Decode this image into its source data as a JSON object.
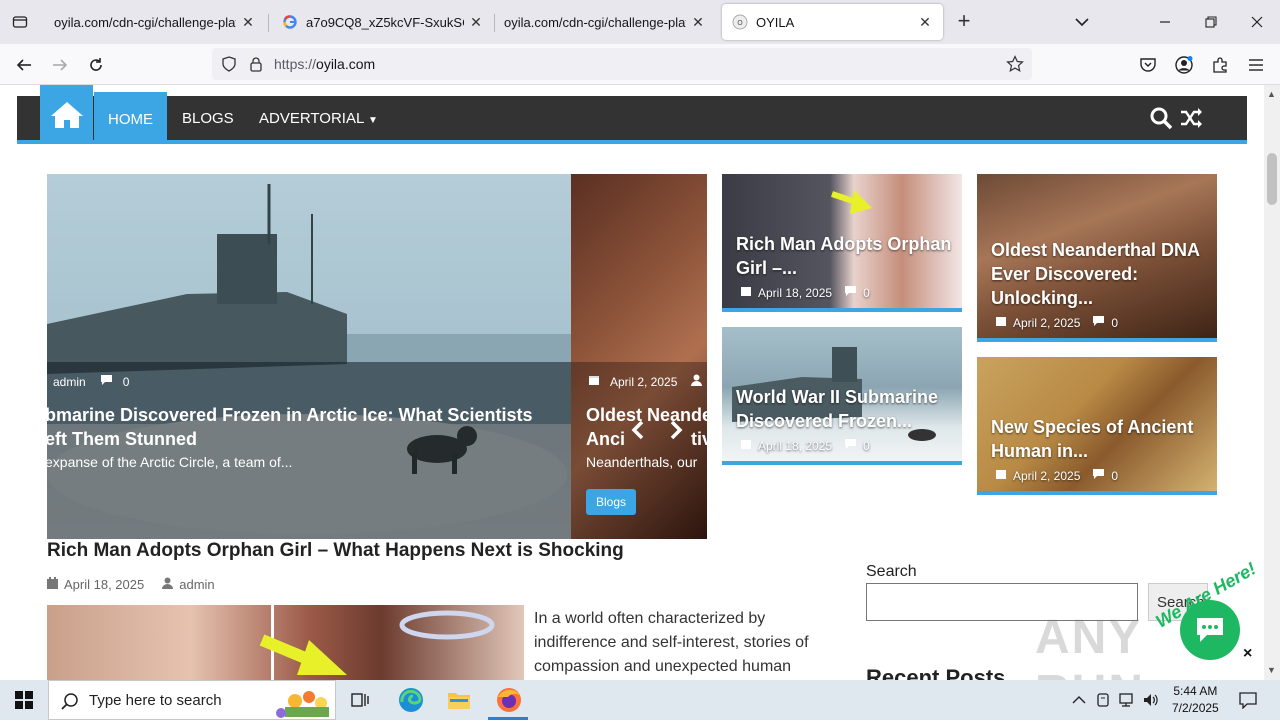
{
  "browser": {
    "tabs": [
      {
        "title": "oyila.com/cdn-cgi/challenge-platfor",
        "active": false
      },
      {
        "title": "a7o9CQ8_xZ5kcVF-SxukSCX0hs",
        "active": false
      },
      {
        "title": "oyila.com/cdn-cgi/challenge-platfor",
        "active": false
      },
      {
        "title": "OYILA",
        "active": true
      }
    ],
    "url_scheme": "https://",
    "url_host": "oyila.com"
  },
  "site": {
    "menu": {
      "home": "HOME",
      "blogs": "BLOGS",
      "advertorial": "ADVERTORIAL"
    },
    "slider": {
      "slide1": {
        "author": "admin",
        "comments": "0",
        "title_line1": "bmarine Discovered Frozen in Arctic Ice: What Scientists",
        "title_line2": "eft Them Stunned",
        "excerpt": "expanse of the Arctic Circle, a team of..."
      },
      "slide2": {
        "date": "April 2, 2025",
        "title_line1": "Oldest Neander",
        "title_line2": "Anci",
        "title_line2b": "tiv",
        "excerpt": "Neanderthals, our",
        "category": "Blogs"
      }
    },
    "cards": [
      {
        "title_line1": "Rich Man Adopts Orphan",
        "title_line2": "Girl –...",
        "date": "April 18, 2025",
        "comments": "0"
      },
      {
        "title_line1": "Oldest Neanderthal DNA",
        "title_line2": "Ever Discovered:",
        "title_line3": "Unlocking...",
        "date": "April 2, 2025",
        "comments": "0"
      },
      {
        "title_line1": "World War II Submarine",
        "title_line2": "Discovered Frozen...",
        "date": "April 18, 2025",
        "comments": "0"
      },
      {
        "title_line1": "New Species of Ancient",
        "title_line2": "Human in...",
        "date": "April 2, 2025",
        "comments": "0"
      }
    ],
    "post": {
      "title": "Rich Man Adopts Orphan Girl – What Happens Next is Shocking",
      "date": "April 18, 2025",
      "author": "admin",
      "text": "In a world often characterized by indifference and self-interest, stories of compassion and unexpected human"
    },
    "sidebar": {
      "search_label": "Search",
      "search_button": "Search",
      "recent_posts": "Recent Posts"
    },
    "chat": {
      "label": "We Are Here!",
      "close": "×"
    },
    "watermark": "ANY RUN"
  },
  "taskbar": {
    "search_placeholder": "Type here to search",
    "time": "5:44 AM",
    "date": "7/2/2025"
  },
  "colors": {
    "accent": "#3ba6e3",
    "nav_bg": "#333333",
    "chat_green": "#1fb862"
  }
}
